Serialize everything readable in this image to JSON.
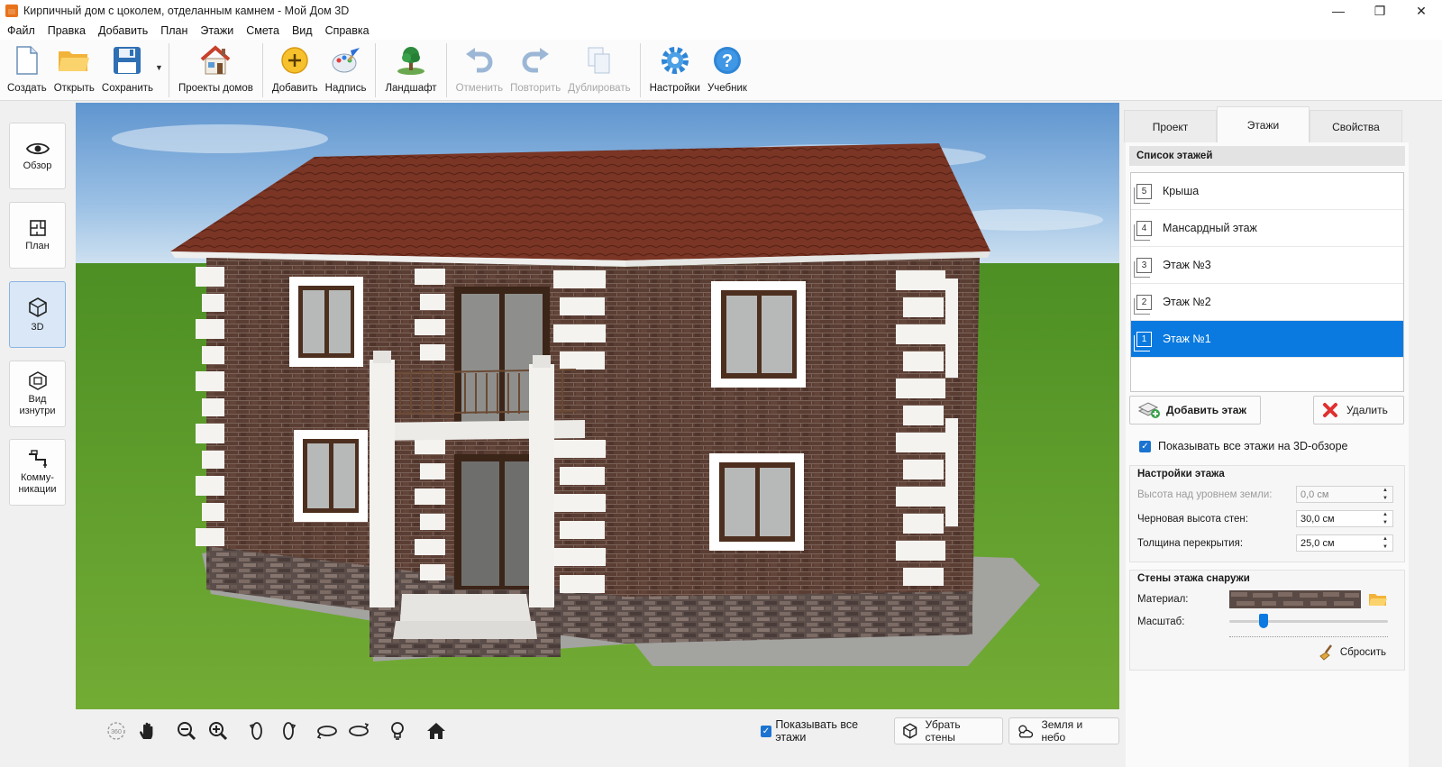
{
  "window": {
    "title": "Кирпичный дом с цоколем, отделанным камнем - Мой Дом 3D",
    "minimize": "—",
    "maximize": "❐",
    "close": "✕"
  },
  "menu": [
    "Файл",
    "Правка",
    "Добавить",
    "План",
    "Этажи",
    "Смета",
    "Вид",
    "Справка"
  ],
  "toolbar": {
    "create": "Создать",
    "open": "Открыть",
    "save": "Сохранить",
    "projects": "Проекты домов",
    "add": "Добавить",
    "label": "Надпись",
    "landscape": "Ландшафт",
    "undo": "Отменить",
    "redo": "Повторить",
    "duplicate": "Дублировать",
    "settings": "Настройки",
    "tutorial": "Учебник"
  },
  "leftnav": {
    "overview": "Обзор",
    "plan": "План",
    "view3d": "3D",
    "inside_1": "Вид",
    "inside_2": "изнутри",
    "comm_1": "Комму-",
    "comm_2": "никации"
  },
  "bottombar": {
    "show_all_floors": "Показывать все этажи",
    "remove_walls": "Убрать стены",
    "earth_sky": "Земля и небо",
    "icon_360": "360"
  },
  "panel": {
    "tabs": [
      "Проект",
      "Этажи",
      "Свойства"
    ],
    "active_tab": "Этажи",
    "floor_list_title": "Список этажей",
    "floors": [
      {
        "num": "5",
        "name": "Крыша"
      },
      {
        "num": "4",
        "name": "Мансардный этаж"
      },
      {
        "num": "3",
        "name": "Этаж №3"
      },
      {
        "num": "2",
        "name": "Этаж №2"
      },
      {
        "num": "1",
        "name": "Этаж №1"
      }
    ],
    "add_floor": "Добавить этаж",
    "delete": "Удалить",
    "show_all_3d": "Показывать все этажи на 3D-обзоре",
    "floor_settings_title": "Настройки этажа",
    "height_above_ground_label": "Высота над уровнем земли:",
    "height_above_ground_value": "0,0 см",
    "rough_wall_height_label": "Черновая высота стен:",
    "rough_wall_height_value": "30,0 см",
    "slab_thickness_label": "Толщина перекрытия:",
    "slab_thickness_value": "25,0 см",
    "walls_outside_title": "Стены этажа снаружи",
    "material_label": "Материал:",
    "scale_label": "Масштаб:",
    "scale_level": 0.2,
    "reset": "Сбросить"
  },
  "colors": {
    "accent": "#0a7ae0",
    "sky": "#6f9fd0",
    "grass": "#5f9a2c",
    "brick": "#5a3d33",
    "roof": "#7a3524"
  }
}
